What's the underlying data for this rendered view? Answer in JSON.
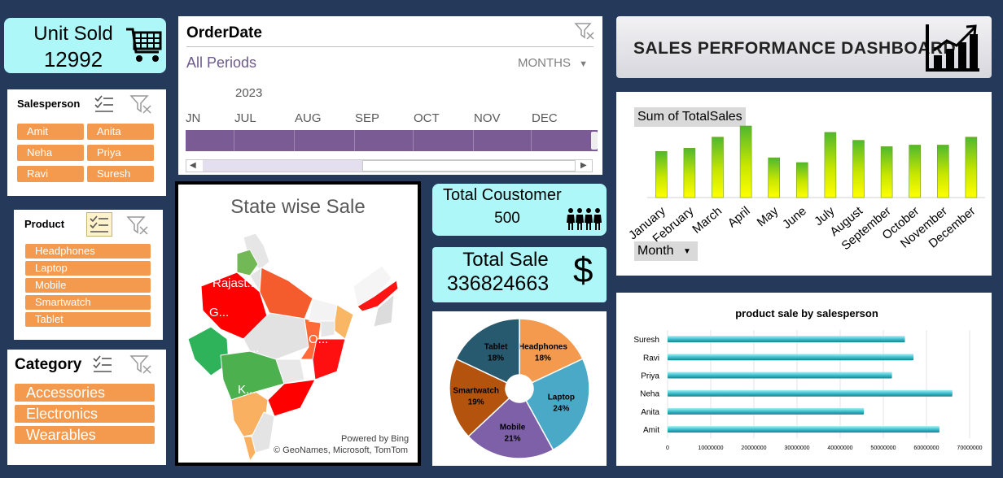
{
  "unit_sold": {
    "label": "Unit Sold",
    "value": "12992",
    "icon": "cart-icon"
  },
  "salesperson_slicer": {
    "title": "Salesperson",
    "items": [
      "Amit",
      "Anita",
      "Neha",
      "Priya",
      "Ravi",
      "Suresh"
    ]
  },
  "product_slicer": {
    "title": "Product",
    "items": [
      "Headphones",
      "Laptop",
      "Mobile",
      "Smartwatch",
      "Tablet"
    ]
  },
  "category_slicer": {
    "title": "Category",
    "items": [
      "Accessories",
      "Electronics",
      "Wearables"
    ]
  },
  "timeline": {
    "title": "OrderDate",
    "period_label": "All Periods",
    "level": "MONTHS",
    "year": "2023",
    "months": [
      "JN",
      "JUL",
      "AUG",
      "SEP",
      "OCT",
      "NOV",
      "DEC"
    ]
  },
  "map": {
    "title": "State wise Sale",
    "labels": [
      "Rajast...",
      "G...",
      "Ma...",
      "O...",
      "K..."
    ],
    "credit1": "Powered by Bing",
    "credit2": "© GeoNames, Microsoft, TomTom"
  },
  "total_customer": {
    "label": "Total Coustomer",
    "value": "500"
  },
  "total_sale": {
    "label": "Total Sale",
    "value": "336824663",
    "symbol": "$"
  },
  "dashboard": {
    "title": "SALES PERFORMANCE DASHBOARD",
    "icon": "bar-chart-icon"
  },
  "colors": {
    "background": "#25395b",
    "slicer_chip": "#f39a4e",
    "kpi_cyan": "#aef7f9",
    "timeline_bar": "#7a5b94"
  },
  "chart_data": [
    {
      "type": "bar",
      "title": "Sum of TotalSales",
      "field_button": "Month",
      "categories": [
        "January",
        "February",
        "March",
        "April",
        "May",
        "June",
        "July",
        "August",
        "September",
        "October",
        "November",
        "December"
      ],
      "values": [
        29,
        31,
        38,
        45,
        25,
        22,
        41,
        36,
        32,
        33,
        33,
        38
      ]
    },
    {
      "type": "pie",
      "labels": [
        "Headphones",
        "Laptop",
        "Mobile",
        "Smartwatch",
        "Tablet"
      ],
      "values": [
        18,
        24,
        21,
        19,
        18
      ],
      "display": [
        "18%",
        "24%",
        "21%",
        "19%",
        "18%"
      ],
      "colors": [
        "#f39a4e",
        "#4aa9c6",
        "#7d60a8",
        "#b3530e",
        "#27596f"
      ]
    },
    {
      "type": "bar",
      "orientation": "horizontal",
      "title": "product sale by salesperson",
      "categories": [
        "Suresh",
        "Ravi",
        "Priya",
        "Neha",
        "Anita",
        "Amit"
      ],
      "values": [
        55000000,
        57000000,
        52000000,
        66000000,
        45500000,
        63000000
      ],
      "xlim": [
        0,
        70000000
      ],
      "ticks": [
        "0",
        "10000000",
        "20000000",
        "30000000",
        "40000000",
        "50000000",
        "60000000",
        "70000000"
      ]
    }
  ]
}
